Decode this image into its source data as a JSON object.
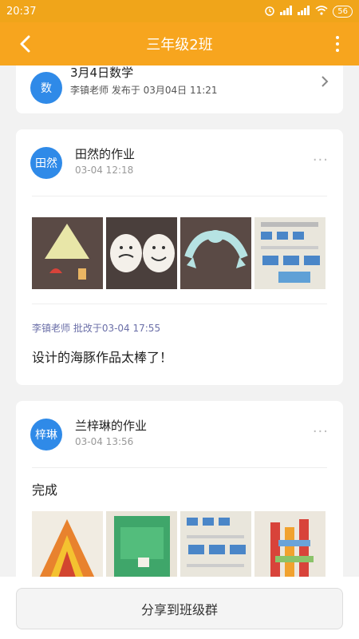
{
  "status": {
    "time": "20:37",
    "battery": "56",
    "alarm_icon": "alarm-icon",
    "signal_icon": "signal-icon",
    "wifi_icon": "wifi-icon"
  },
  "nav": {
    "title": "三年级2班",
    "back_icon": "back-arrow-icon",
    "more_icon": "more-vertical-icon"
  },
  "notice": {
    "avatar_text": "数",
    "title": "3月4日数学",
    "subtitle": "李镇老师 发布于 03月04日 11:21"
  },
  "posts": [
    {
      "avatar_text": "田然",
      "name": "田然的作业",
      "time": "03-04 12:18",
      "photos": [
        "triangle-umbrella-craft",
        "face-drawings",
        "dolphin-cutout",
        "math-worksheet"
      ],
      "comment_meta": "李镇老师 批改于03-04 17:55",
      "comment": "设计的海豚作品太棒了！"
    },
    {
      "avatar_text": "梓琳",
      "name": "兰梓琳的作业",
      "time": "03-04 13:56",
      "text": "完成",
      "photos": [
        "triangle-art-book",
        "green-paper-craft",
        "math-worksheet",
        "colorful-character-art"
      ]
    }
  ],
  "bottom": {
    "share_label": "分享到班级群"
  },
  "colors": {
    "accent": "#f7a51e",
    "avatar": "#2f8ae8"
  }
}
